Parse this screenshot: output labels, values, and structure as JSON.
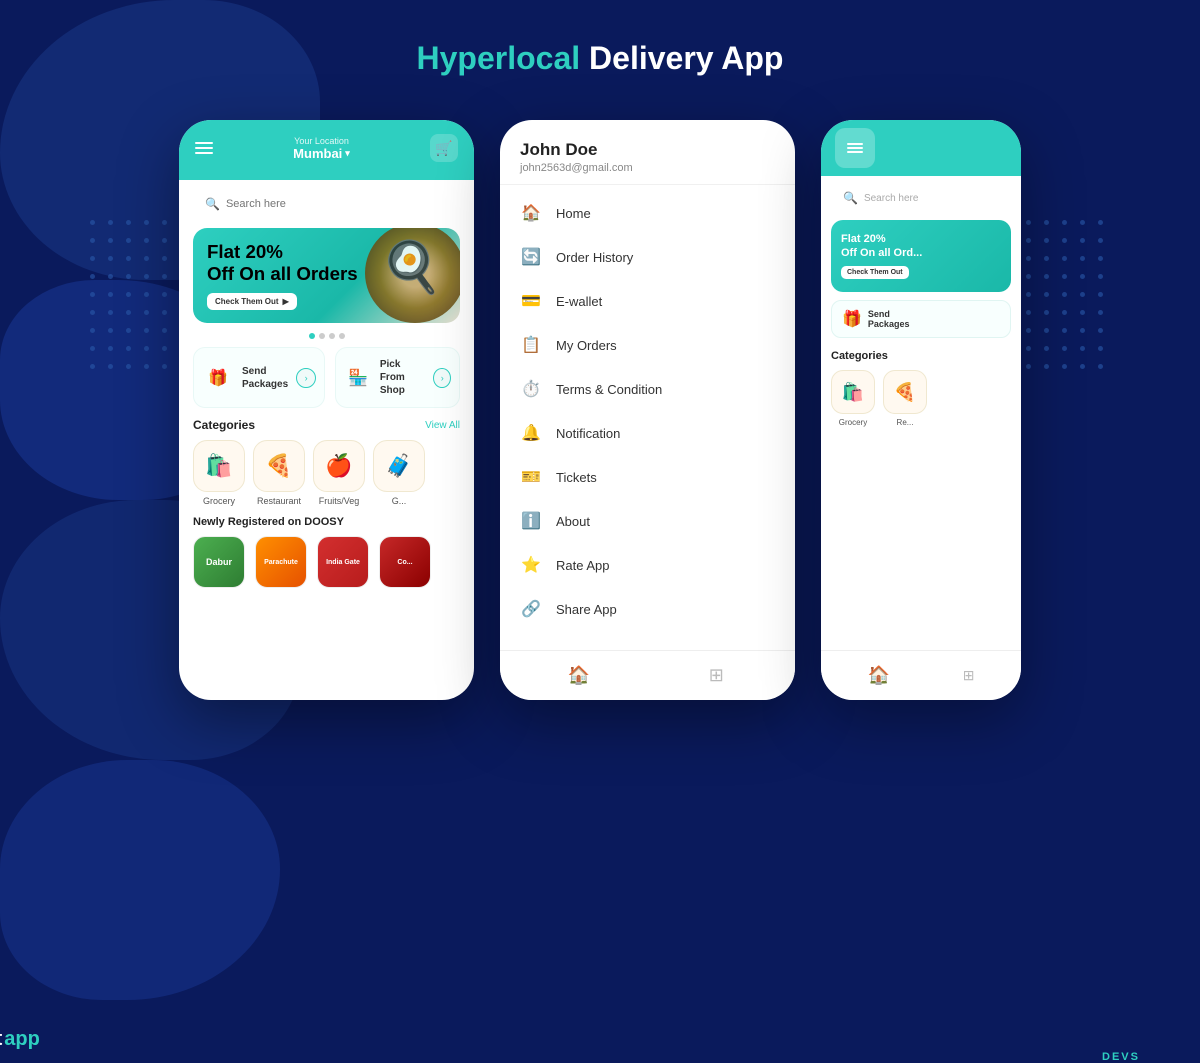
{
  "page": {
    "title_part1": "Hyperlocal",
    "title_part2": " Delivery App"
  },
  "logo": {
    "part1": "Expert",
    "part2": "app",
    "part3": "DEVS"
  },
  "phone1": {
    "location_label": "Your Location",
    "location_name": "Mumbai",
    "search_placeholder": "Search here",
    "banner": {
      "line1": "Flat 20%",
      "line2": "Off On all Orders",
      "btn": "Check Them Out"
    },
    "quick_actions": [
      {
        "label": "Send\nPackages",
        "icon": "🎁"
      },
      {
        "label": "Pick\nFrom Shop",
        "icon": "🏪"
      }
    ],
    "categories_title": "Categories",
    "view_all": "View All",
    "categories": [
      {
        "label": "Grocery",
        "icon": "🛍️"
      },
      {
        "label": "Restaurant",
        "icon": "🍕"
      },
      {
        "label": "Fruits/Veg",
        "icon": "🍎"
      },
      {
        "label": "G...",
        "icon": "🧳"
      }
    ],
    "newly_title": "Newly Registered on DOOSY",
    "brands": [
      {
        "label": "Dabur",
        "color": "dabur"
      },
      {
        "label": "Parachute",
        "color": "brand-orange"
      },
      {
        "label": "India Gate",
        "color": "india-gate"
      },
      {
        "label": "Co...",
        "color": "brand-red"
      }
    ]
  },
  "phone2": {
    "user_name": "John Doe",
    "user_email": "john2563d@gmail.com",
    "menu_items": [
      {
        "label": "Home",
        "icon": "🏠"
      },
      {
        "label": "Order History",
        "icon": "🔄"
      },
      {
        "label": "E-wallet",
        "icon": "💳"
      },
      {
        "label": "My Orders",
        "icon": "📋"
      },
      {
        "label": "Terms & Condition",
        "icon": "⏱️"
      },
      {
        "label": "Notification",
        "icon": "🔔"
      },
      {
        "label": "Tickets",
        "icon": "🎫"
      },
      {
        "label": "About",
        "icon": "ℹ️"
      },
      {
        "label": "Rate App",
        "icon": "⭐"
      },
      {
        "label": "Share App",
        "icon": "🔗"
      }
    ]
  }
}
